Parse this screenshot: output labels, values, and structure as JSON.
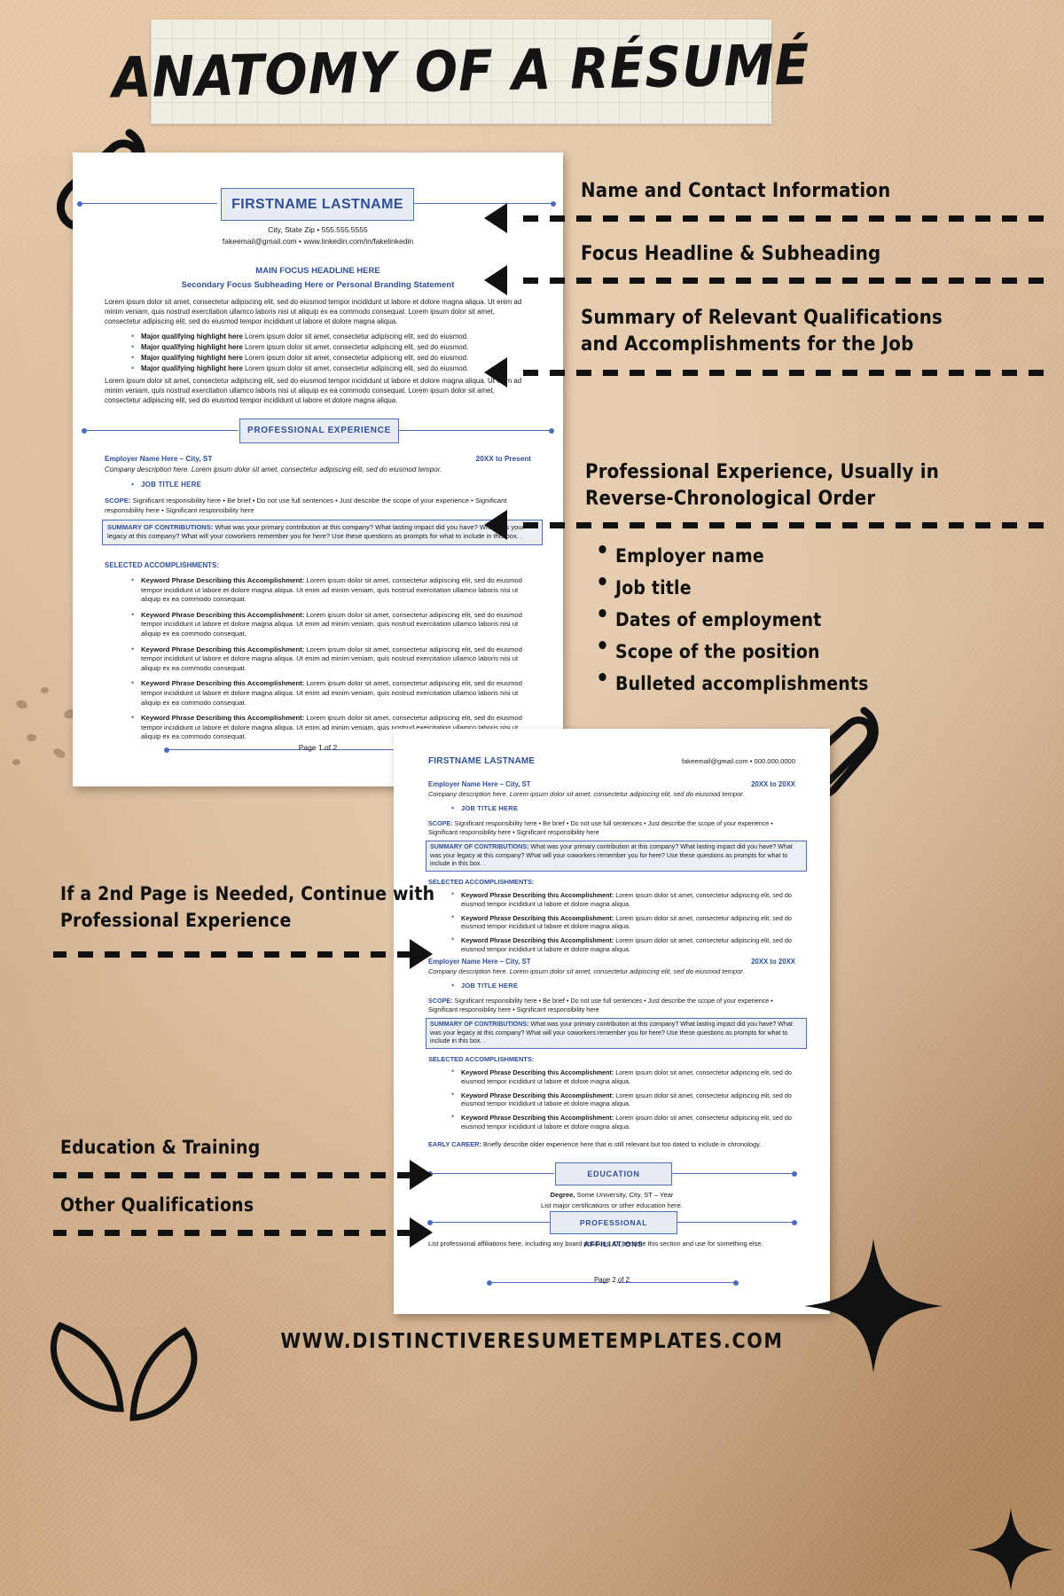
{
  "poster": {
    "title": "ANATOMY OF A RÉSUMÉ",
    "footer_url": "WWW.DISTINCTIVERESUMETEMPLATES.COM",
    "accent_blue": "#2f4f9b",
    "rule_blue": "#4a6ebb",
    "plate_fill": "#e7ebf3",
    "paper_bg": "#c29b74"
  },
  "annotations": {
    "right": [
      {
        "id": "name-contact",
        "text": "Name and Contact Information"
      },
      {
        "id": "focus-headline",
        "text": "Focus Headline & Subheading"
      },
      {
        "id": "summary-qualifications",
        "line1": "Summary of Relevant Qualifications",
        "line2": "and Accomplishments for the Job"
      },
      {
        "id": "professional-experience",
        "line1": "Professional Experience, Usually in",
        "line2": "Reverse-Chronological Order"
      }
    ],
    "right_bullets": [
      "Employer name",
      "Job title",
      "Dates of employment",
      "Scope of the position",
      "Bulleted accomplishments"
    ],
    "left": [
      {
        "id": "second-page",
        "line1": "If a 2nd Page is Needed, Continue with",
        "line2": "Professional Experience"
      },
      {
        "id": "education-training",
        "line1": "Education & Training",
        "line2": ""
      },
      {
        "id": "other-qualifications",
        "line1": "Other Qualifications",
        "line2": ""
      }
    ]
  },
  "resume_page1": {
    "name": "FIRSTNAME LASTNAME",
    "contact_line1": "City, State Zip  •  555.555.5555",
    "contact_line2": "fakeemail@gmail.com  •  www.linkedin.com/in/fakelinkedin",
    "headline": "MAIN FOCUS HEADLINE HERE",
    "subheading": "Secondary Focus Subheading Here or Personal Branding Statement",
    "summary_paragraph": "Lorem ipsum dolor sit amet, consectetur adipiscing elit, sed do eiusmod tempor incididunt ut labore et dolore magna aliqua. Ut enim ad minim veniam, quis nostrud exercitation ullamco laboris nisi ut aliquip ex ea commodo consequat. Lorem ipsum dolor sit amet, consectetur adipiscing elit, sed do eiusmod tempor incididunt ut labore et dolore magna aliqua.",
    "highlight_bold": "Major qualifying highlight here",
    "highlight_rest": "Lorem ipsum dolor sit amet, consectetur adipiscing elit, sed do eiusmod.",
    "highlights_count": 4,
    "summary_paragraph2": "Lorem ipsum dolor sit amet, consectetur adipiscing elit, sed do eiusmod tempor incididunt ut labore et dolore magna aliqua. Ut enim ad minim veniam, quis nostrud exercitation ullamco laboris nisi ut aliquip ex ea commodo consequat. Lorem ipsum dolor sit amet, consectetur adipiscing elit, sed do eiusmod tempor incididunt ut labore et dolore magna aliqua.",
    "section_professional_experience": "PROFESSIONAL EXPERIENCE",
    "employer": "Employer Name Here – City, ST",
    "dates": "20XX to Present",
    "company_description": "Company description here. Lorem ipsum dolor sit amet, consectetur adipiscing elit, sed do eiusmod tempor.",
    "job_title": "JOB TITLE HERE",
    "scope_label": "SCOPE:",
    "scope_line1": "Significant responsibility here  •  Be brief  •  Do not use full sentences  •  Just describe the scope of your experience  •",
    "scope_line2": "Significant responsibility here  •  Significant responsibility here",
    "contrib_label": "SUMMARY OF CONTRIBUTIONS:",
    "contrib_text": "What was your primary contribution at this company? What lasting impact did you have? What was your legacy at this company? What will your coworkers remember you for here? Use these questions as prompts for what to include in this box.  .",
    "accomplishments_label": "SELECTED ACCOMPLISHMENTS:",
    "accomplishment_bold": "Keyword Phrase Describing this Accomplishment:",
    "accomplishment_rest": "Lorem ipsum dolor sit amet, consectetur adipiscing elit, sed do eiusmod tempor incididunt ut labore et dolore magna aliqua. Ut enim ad minim veniam, quis nostrud exercitation ullamco laboris nisi ut aliquip ex ea commodo consequat.",
    "accomplishments_count": 5,
    "page_footer": "Page 1 of 2"
  },
  "resume_page2": {
    "name": "FIRSTNAME LASTNAME",
    "contact": "fakeemail@gmail.com  •  000.000.0000",
    "jobs": [
      {
        "employer": "Employer Name Here – City, ST",
        "dates": "20XX to 20XX",
        "company_description": "Company description here. Lorem ipsum dolor sit amet, consectetur adipiscing elit, sed do eiusmod tempor.",
        "job_title": "JOB TITLE HERE",
        "scope_label": "SCOPE:",
        "scope_line1": "Significant responsibility here  •  Be brief  •  Do not use full sentences  •  Just describe the scope of your experience  •",
        "scope_line2": "Significant responsibility here  •  Significant responsibility here",
        "contrib_label": "SUMMARY OF CONTRIBUTIONS:",
        "contrib_text": "What was your primary contribution at this company? What lasting impact did you have? What was your legacy at this company? What will your coworkers remember you for here? Use these questions as prompts for what to include in this box.  .",
        "accomplishments_label": "SELECTED ACCOMPLISHMENTS:",
        "accomplishment_bold": "Keyword Phrase Describing this Accomplishment:",
        "accomplishment_rest": "Lorem ipsum dolor sit amet, consectetur adipiscing elit, sed do eiusmod tempor incididunt ut labore et dolore magna aliqua.",
        "accomplishments_count": 3
      },
      {
        "employer": "Employer Name Here – City, ST",
        "dates": "20XX to 20XX",
        "company_description": "Company description here. Lorem ipsum dolor sit amet, consectetur adipiscing elit, sed do eiusmod tempor.",
        "job_title": "JOB TITLE HERE",
        "scope_label": "SCOPE:",
        "scope_line1": "Significant responsibility here  •  Be brief  •  Do not use full sentences  •  Just describe the scope of your experience  •",
        "scope_line2": "Significant responsibility here  •  Significant responsibility here",
        "contrib_label": "SUMMARY OF CONTRIBUTIONS:",
        "contrib_text": "What was your primary contribution at this company? What lasting impact did you have? What was your legacy at this company? What will your coworkers remember you for here? Use these questions as prompts for what to include in this box.  .",
        "accomplishments_label": "SELECTED ACCOMPLISHMENTS:",
        "accomplishment_bold": "Keyword Phrase Describing this Accomplishment:",
        "accomplishment_rest": "Lorem ipsum dolor sit amet, consectetur adipiscing elit, sed do eiusmod tempor incididunt ut labore et dolore magna aliqua.",
        "accomplishments_count": 3
      }
    ],
    "early_career_label": "EARLY CAREER:",
    "early_career_text": "Briefly describe older experience here that is still relevant but too dated to include in chronology.",
    "section_education": "EDUCATION",
    "education_degree_bold": "Degree,",
    "education_degree_rest": "Some University, City, ST – Year",
    "education_note": "List major certifications or other education here.",
    "section_affiliations": "PROFESSIONAL AFFILIATIONS",
    "affiliations_text": "List professional affiliations here, including any board positions. Or, rename this section and use for something else.",
    "page_footer": "Page 2 of 2"
  }
}
